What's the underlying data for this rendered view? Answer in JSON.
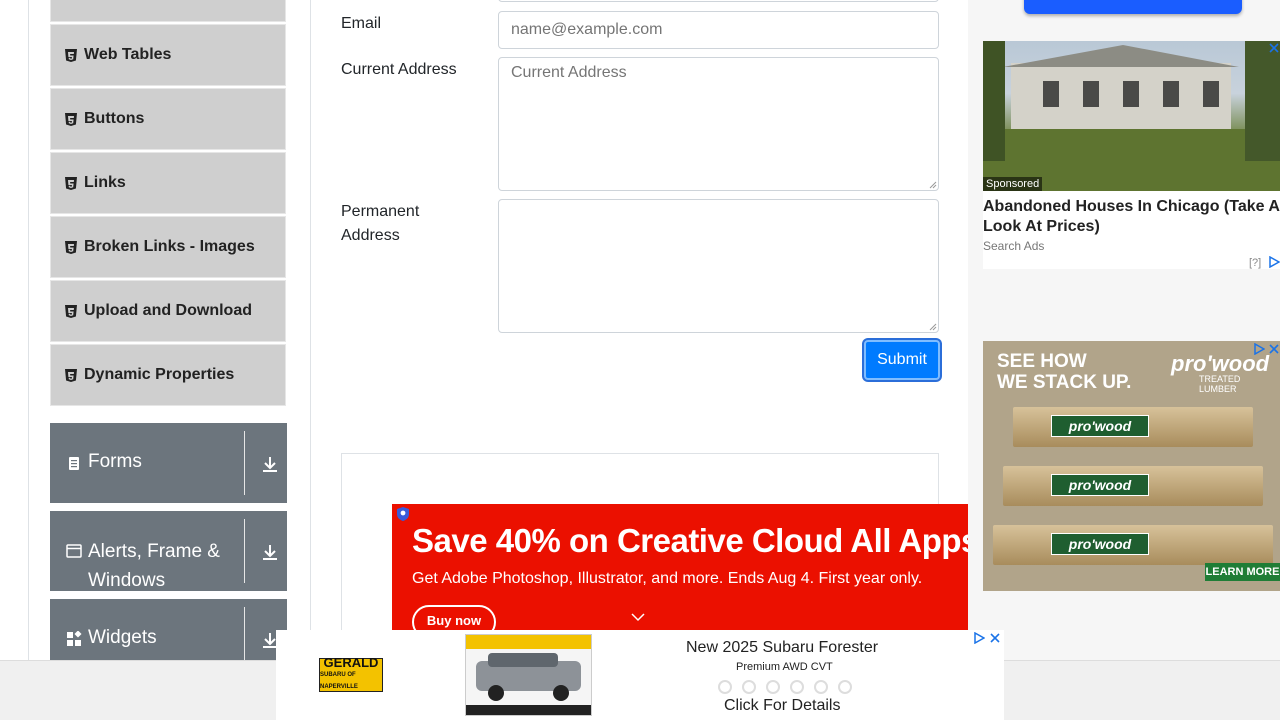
{
  "sidebar": {
    "items": [
      {
        "label": "Web Tables"
      },
      {
        "label": "Buttons"
      },
      {
        "label": "Links"
      },
      {
        "label": "Broken Links - Images"
      },
      {
        "label": "Upload and Download"
      },
      {
        "label": "Dynamic Properties"
      }
    ],
    "groups": [
      {
        "label": "Forms",
        "icon": "clipboard-icon"
      },
      {
        "label": "Alerts, Frame & Windows",
        "label_line1": "Alerts, Frame &",
        "label_line2": "Windows",
        "icon": "window-icon"
      },
      {
        "label": "Widgets",
        "icon": "widgets-icon"
      }
    ]
  },
  "form": {
    "email": {
      "label": "Email",
      "placeholder": "name@example.com",
      "value": ""
    },
    "current_address": {
      "label": "Current Address",
      "placeholder": "Current Address",
      "value": ""
    },
    "permanent_address": {
      "label_line1": "Permanent",
      "label_line2": "Address",
      "placeholder": "",
      "value": ""
    },
    "submit_label": "Submit"
  },
  "ads": {
    "adobe": {
      "headline": "Save 40% on Creative Cloud All Apps",
      "subline": "Get Adobe Photoshop, Illustrator, and more. Ends Aug 4. First year only.",
      "button": "Buy now"
    },
    "house": {
      "sponsored": "Sponsored",
      "title": "Abandoned Houses In Chicago (Take A Look At Prices)",
      "source": "Search Ads",
      "help": "[?]"
    },
    "lumber": {
      "line1": "SEE HOW",
      "line2": "WE STACK UP.",
      "brand": "pro'wood",
      "brand_sub": "TREATED LUMBER",
      "learn_more": "LEARN MORE",
      "stamp": "pro'wood"
    },
    "subaru": {
      "logo_top": "GERALD",
      "logo_bottom": "SUBARU OF NAPERVILLE",
      "title": "New 2025 Subaru Forester",
      "subtitle": "Premium AWD CVT",
      "cta": "Click For Details"
    }
  },
  "colors": {
    "accent": "#007bff",
    "sidebar_group": "#6c757d",
    "sidebar_item": "#cfcfcf",
    "adobe_red": "#eb1000"
  }
}
